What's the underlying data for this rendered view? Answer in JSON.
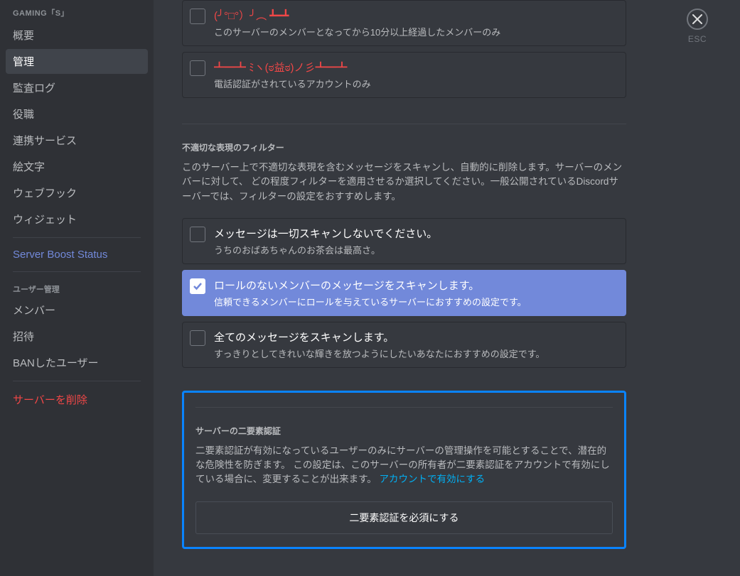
{
  "sidebar": {
    "header": "GAMING「S」",
    "items": [
      {
        "label": "概要",
        "name": "sidebar-item-overview"
      },
      {
        "label": "管理",
        "name": "sidebar-item-moderation",
        "active": true
      },
      {
        "label": "監査ログ",
        "name": "sidebar-item-audit-log"
      },
      {
        "label": "役職",
        "name": "sidebar-item-roles"
      },
      {
        "label": "連携サービス",
        "name": "sidebar-item-integrations"
      },
      {
        "label": "絵文字",
        "name": "sidebar-item-emoji"
      },
      {
        "label": "ウェブフック",
        "name": "sidebar-item-webhooks"
      },
      {
        "label": "ウィジェット",
        "name": "sidebar-item-widget"
      }
    ],
    "boost": "Server Boost Status",
    "user_header": "ユーザー管理",
    "user_items": [
      {
        "label": "メンバー",
        "name": "sidebar-item-members"
      },
      {
        "label": "招待",
        "name": "sidebar-item-invites"
      },
      {
        "label": "BANしたユーザー",
        "name": "sidebar-item-bans"
      }
    ],
    "delete": "サーバーを削除"
  },
  "verification": {
    "options": [
      {
        "title": "(╯°□°）╯︵ ┻━┻",
        "desc": "このサーバーのメンバーとなってから10分以上経過したメンバーのみ",
        "red": true,
        "name": "verification-option-10min"
      },
      {
        "title": "┻━┻ ﾐヽ(ಠ益ಠ)ノ彡┻━┻",
        "desc": "電話認証がされているアカウントのみ",
        "red": true,
        "name": "verification-option-phone"
      }
    ]
  },
  "filter": {
    "title": "不適切な表現のフィルター",
    "desc": "このサーバー上で不適切な表現を含むメッセージをスキャンし、自動的に削除します。サーバーのメンバーに対して、 どの程度フィルターを適用させるか選択してください。一般公開されているDiscordサーバーでは、フィルターの設定をおすすめします。",
    "options": [
      {
        "title": "メッセージは一切スキャンしないでください。",
        "desc": "うちのおばあちゃんのお茶会は最高さ。",
        "name": "filter-option-none"
      },
      {
        "title": "ロールのないメンバーのメッセージをスキャンします。",
        "desc": "信頼できるメンバーにロールを与えているサーバーにおすすめの設定です。",
        "selected": true,
        "name": "filter-option-no-role"
      },
      {
        "title": "全てのメッセージをスキャンします。",
        "desc": "すっきりとしてきれいな輝きを放つようにしたいあなたにおすすめの設定です。",
        "name": "filter-option-all"
      }
    ]
  },
  "mfa": {
    "title": "サーバーの二要素認証",
    "desc": "二要素認証が有効になっているユーザーのみにサーバーの管理操作を可能とすることで、潜在的な危険性を防ぎます。 この設定は、このサーバーの所有者が二要素認証をアカウントで有効にしている場合に、変更することが出来ます。",
    "link": "アカウントで有効にする",
    "button": "二要素認証を必須にする"
  },
  "close": {
    "label": "ESC"
  }
}
